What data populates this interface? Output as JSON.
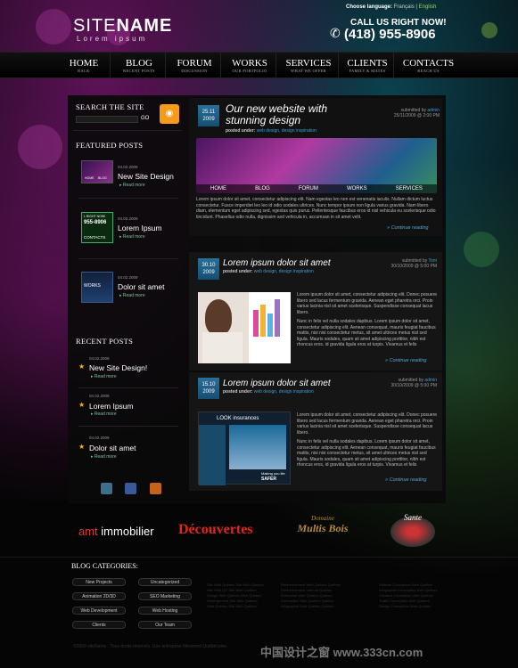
{
  "header": {
    "logo_site": "SITE",
    "logo_name": "NAME",
    "tagline": "Lorem ipsum",
    "language_label": "Choose language:",
    "language_fr": "Français",
    "language_sep": "|",
    "language_en": "English",
    "call_label": "CALL US RIGHT NOW!",
    "phone": "(418) 955-8906"
  },
  "nav": [
    {
      "label": "HOME",
      "sub": "BACK"
    },
    {
      "label": "BLOG",
      "sub": "RECENT POSTS"
    },
    {
      "label": "FORUM",
      "sub": "DISCUSSION"
    },
    {
      "label": "WORKS",
      "sub": "OUR PORTFOLIO"
    },
    {
      "label": "SERVICES",
      "sub": "WHAT WE OFFER"
    },
    {
      "label": "CLIENTS",
      "sub": "FAMILY & MATES"
    },
    {
      "label": "CONTACTS",
      "sub": "REACH US"
    }
  ],
  "sidebar": {
    "search_title": "SEARCH THE SITE",
    "search_button": "GO",
    "featured_title": "FEATURED POSTS",
    "featured": [
      {
        "date": "04.02.2009",
        "title": "New Site Design",
        "more": "Read more"
      },
      {
        "date": "04.02.2009",
        "title": "Lorem Ipsum",
        "more": "Read more"
      },
      {
        "date": "04.02.2009",
        "title": "Dolor sit amet",
        "more": "Read more"
      }
    ],
    "recent_title": "RECENT POSTS",
    "recent": [
      {
        "date": "04.02.2009",
        "title": "New Site Design!",
        "more": "Read more"
      },
      {
        "date": "04.02.2009",
        "title": "Lorem Ipsum",
        "more": "Read more"
      },
      {
        "date": "04.02.2009",
        "title": "Dolor sit amet",
        "more": "Read more"
      }
    ]
  },
  "posts": [
    {
      "day": "25.11",
      "year": "2009",
      "title1": "Our new website with",
      "title2": "stunning design",
      "posted_label": "posted under:",
      "cats": "web design, design inspiration",
      "submitted_label": "submitted by",
      "author": "admin",
      "datetime": "25/11/2009 @ 2:00 PM",
      "text": "Lorem ipsum dolor sit amet, consectetur adipiscing elit. Nam egestas leo non est venenatis iaculis. Nullam dictum luctus consectetur. Fusce imperdiet leo leo id odio sodales ultrices. Nunc tempor ipsum non ligula varius gravida. Nam libero diam, elementum eget adipiscing sed, egestas quis purus. Pellentesque faucibus eros id nisl vehicula eu scelerisque odio tincidunt. Phasellus odio nulla, dignissim sed vehicula in, accumsan in sit amet velit.",
      "continue": "Continue reading"
    },
    {
      "day": "30.10",
      "year": "2009",
      "title1": "Lorem ipsum dolor sit amet",
      "posted_label": "posted under:",
      "cats": "web design, design inspiration",
      "submitted_label": "submitted by",
      "author": "Tom",
      "datetime": "30/10/2009 @ 5:00 PM",
      "text1": "Lorem ipsum dolor sit amet, consectetur adipiscing elit. Donec posuere libero sed lacus fermentum gravida. Aenean eget pharetra orci. Proin varius lacinia nisl sit amet scelerisque. Suspendisse consequat lacus libero.",
      "text2": "Nunc in felis vel nulla sodales dapibus. Lorem ipsum dolor sit amet, consectetur adipiscing elit. Aenean consequat, mauris feugiat faucibus mattis, nisi nisi consectetur metus, sit amet ultrices metus nisl sed ligula. Mauris sodales, quam sit amet adipiscing porttitor, nibh est rhoncus eros, id gravida ligula eros at turpis. Vivamus et felis",
      "continue": "Continue reading"
    },
    {
      "day": "15.10",
      "year": "2009",
      "title1": "Lorem ipsum dolor sit amet",
      "posted_label": "posted under:",
      "cats": "web design, design inspiration",
      "submitted_label": "submitted by",
      "author": "admin",
      "datetime": "30/10/2009 @ 5:00 PM",
      "text1": "Lorem ipsum dolor sit amet, consectetur adipiscing elit. Donec posuere libero sed lacus fermentum gravida. Aenean eget pharetra orci. Proin varius lacinia nisl sit amet scelerisque. Suspendisse consequat lacus libero.",
      "text2": "Nunc in felis vel nulla sodales dapibus. Lorem ipsum dolor sit amet, consectetur adipiscing elit. Aenean consequat, mauris feugiat faucibus mattis, nisi nisi consectetur metus, sit amet ultrices metus nisl sed ligula. Mauris sodales, quam sit amet adipiscing porttitor, nibh est rhoncus eros, id gravida ligula eros at turpis. Vivamus et felis",
      "continue": "Continue reading",
      "image_title": "LOOK insurances",
      "image_caption1": "Making you life",
      "image_caption2": "SAFER"
    }
  ],
  "banner_nav": [
    "HOME",
    "BLOG",
    "FORUM",
    "WORKS",
    "SERVICES"
  ],
  "thumb_nav": [
    "HOME",
    "BLOG"
  ],
  "thumb2_line1": "L RIGHT NOW!",
  "thumb2_line2": "955-8906",
  "thumb2_line3": "CONTACTS",
  "thumb3_label": "WORKS",
  "partners": {
    "amt1": "amt",
    "amt2": "immobilier",
    "decouvertes": "Découvertes",
    "domaine_top": "Domaine",
    "domaine_main": "Multis Bois",
    "sante": "Sante"
  },
  "footer": {
    "categories_title": "BLOG CATEGORIES:",
    "categories": [
      "New Projects",
      "Uncategorized",
      "Animation 2D/3D",
      "SEO Marketing",
      "Web Development",
      "Web Hosting",
      "Clients",
      "Our Team"
    ],
    "col1": [
      "Site Web Québec Site Web Québec",
      "Site Web QC Site Web Québec",
      "Design Web Québec Web Québec",
      "Hébergement Site Web Québec",
      "Web Québec Site Web Québec"
    ],
    "col2": [
      "Référencement Web Québec Québec",
      "Référencement Internet Québec",
      "Entreprise Web Québec Québec",
      "Conception Web Québec Québec",
      "Infographie Web Québec Québec"
    ],
    "col3": [
      "Website Conception Web Québec",
      "Infographie Conception Web Québec",
      "Création Conception Web Québec",
      "Traffic Conception Web Québec",
      "Design Conception Web Québec"
    ],
    "copyright": "©2009 siteName . Tous droits réservés. Une entreprise fièrement Québécoise.",
    "watermark": "中国设计之窗 www.333cn.com"
  },
  "colors": {
    "accent_blue": "#3a9ed6",
    "rss_orange": "#f49b1a",
    "star": "#f5b800"
  }
}
